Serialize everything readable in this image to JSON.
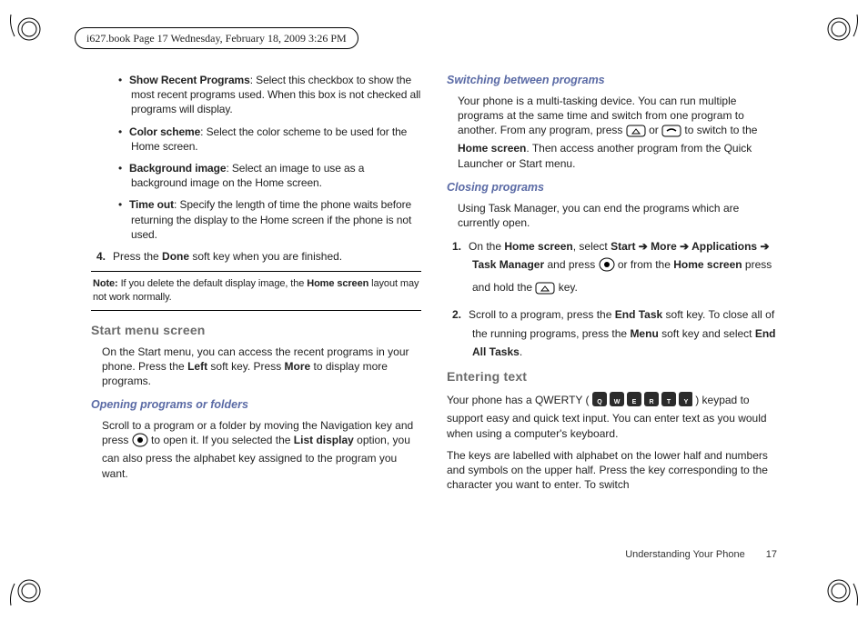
{
  "header": {
    "tag": "i627.book  Page 17  Wednesday, February 18, 2009  3:26 PM"
  },
  "left": {
    "bullets": [
      {
        "title": "Show Recent Programs",
        "body": ": Select this checkbox to show the most recent programs used. When this box is not checked all programs will display."
      },
      {
        "title": "Color scheme",
        "body": ": Select the color scheme to be used for the Home screen."
      },
      {
        "title": "Background image",
        "body": ": Select an image to use as a background image on the Home screen."
      },
      {
        "title": "Time out",
        "body": ": Specify the length of time the phone waits before returning the display to the Home screen if the phone is not used."
      }
    ],
    "step4_num": "4.",
    "step4_a": "Press the ",
    "step4_b": "Done",
    "step4_c": " soft key when you are finished.",
    "note": {
      "label": "Note:",
      "a": "If you delete the default display image, the ",
      "b": "Home screen",
      "c": " layout may not work normally."
    },
    "h1_start": "Start menu screen",
    "start_a": "On the Start menu, you can access the recent programs in your phone. Press the ",
    "start_b": "Left",
    "start_c": " soft key. Press ",
    "start_d": "More",
    "start_e": " to display more programs.",
    "h2_open": "Opening programs or folders",
    "open_a": "Scroll to a program or a folder by moving the Navigation key and press ",
    "open_b": " to open it. If you selected the ",
    "open_c": "List display",
    "open_d": " option, you can also press the alphabet key assigned to the program you want."
  },
  "right": {
    "h2_switch": "Switching between programs",
    "switch_a": "Your phone is a multi-tasking device. You can run multiple programs at the same time and switch from one program to another. From any program, press ",
    "switch_b": " or ",
    "switch_c": " to switch to the ",
    "switch_d": "Home screen",
    "switch_e": ". Then access another program from the Quick Launcher or Start menu.",
    "h2_close": "Closing programs",
    "close_p": "Using Task Manager, you can end the programs which are currently open.",
    "step1_num": "1.",
    "s1_a": "On the ",
    "s1_b": "Home screen",
    "s1_c": ", select ",
    "s1_d": "Start ➔ More ➔ Applications ➔ Task Manager",
    "s1_e": " and press ",
    "s1_f": " or from the ",
    "s1_g": "Home screen",
    "s1_h": " press and hold the ",
    "s1_i": " key.",
    "step2_num": "2.",
    "s2_a": "Scroll to a program, press the ",
    "s2_b": "End Task",
    "s2_c": " soft key. To close all of the running programs, press the ",
    "s2_d": "Menu",
    "s2_e": " soft key and select ",
    "s2_f": "End All Tasks",
    "s2_g": ".",
    "h1_enter": "Entering text",
    "enter_a": "Your phone has a QWERTY ( ",
    "enter_b": " ) keypad to support easy and quick text input. You can enter text as you would when using a computer's keyboard.",
    "enter_p2": "The keys are labelled with alphabet on the lower half and numbers and symbols on the upper half. Press the key corresponding to the character you want to enter. To switch"
  },
  "footer": {
    "section": "Understanding Your Phone",
    "page": "17"
  }
}
